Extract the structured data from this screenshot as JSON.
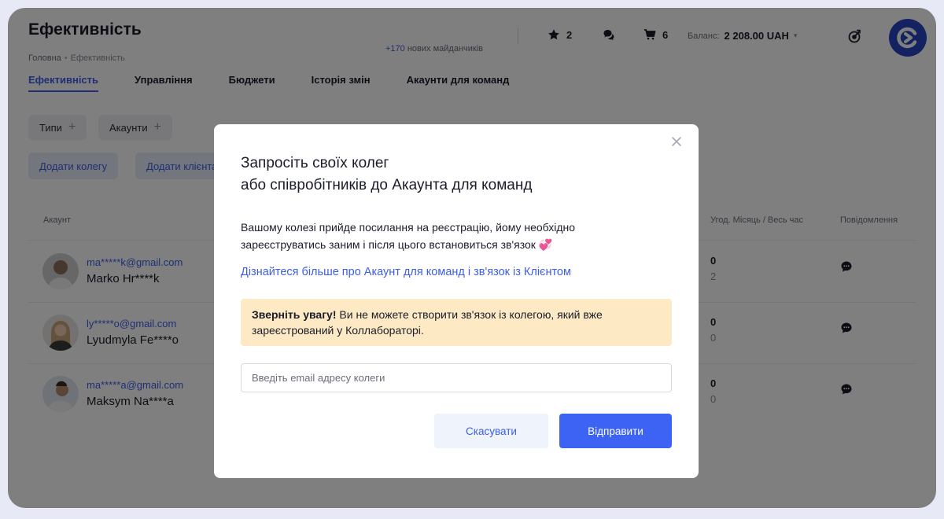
{
  "header": {
    "title": "Ефективність",
    "breadcrumb": [
      "Головна",
      "Ефективність"
    ],
    "platforms_count": "+170",
    "platforms_text": "нових майданчиків",
    "favorites_count": "2",
    "cart_count": "6",
    "balance_label": "Баланс:",
    "balance_value": "2 208.00 UAH"
  },
  "tabs": [
    {
      "label": "Ефективність",
      "active": true
    },
    {
      "label": "Управління"
    },
    {
      "label": "Бюджети"
    },
    {
      "label": "Історія змін"
    },
    {
      "label": "Акаунти для команд"
    }
  ],
  "filters": {
    "types": "Типи",
    "accounts": "Акаунти"
  },
  "actions": {
    "add_colleague": "Додати колегу",
    "add_client": "Додати клієнта"
  },
  "table": {
    "columns": {
      "account": "Акаунт",
      "deals": "Угод. Місяць / Весь час",
      "messages": "Повідомлення"
    },
    "rows": [
      {
        "email": "ma*****k@gmail.com",
        "name": "Marko Hr****k",
        "month": "0",
        "total": "2"
      },
      {
        "email": "ly*****o@gmail.com",
        "name": "Lyudmyla Fe****o",
        "month": "0",
        "total": "0"
      },
      {
        "email": "ma*****a@gmail.com",
        "name": "Maksym Na****a",
        "month": "0",
        "total": "0"
      }
    ]
  },
  "modal": {
    "title_line1": "Запросіть своїх колег",
    "title_line2": "або співробітників до Акаунта для команд",
    "desc_line1": "Вашому колезі прийде посилання на реєстрацію, йому необхідно",
    "desc_line2": "зареєструватись заним і після цього встановиться зв'язок",
    "heart_emoji": "💞",
    "link": "Дізнайтеся більше про Акаунт для команд і зв'язок із Клієнтом",
    "warning_bold": "Зверніть увагу!",
    "warning_line1": " Ви не можете створити зв'язок із колегою, який вже",
    "warning_line2": "зареєстрований у Коллабораторі.",
    "email_placeholder": "Введіть email адресу колеги",
    "cancel": "Скасувати",
    "send": "Відправити"
  },
  "colors": {
    "accent": "#3d5ee6",
    "send_button": "#3d63f5",
    "warning_bg": "#fde9c4",
    "logo": "#2745c2"
  }
}
